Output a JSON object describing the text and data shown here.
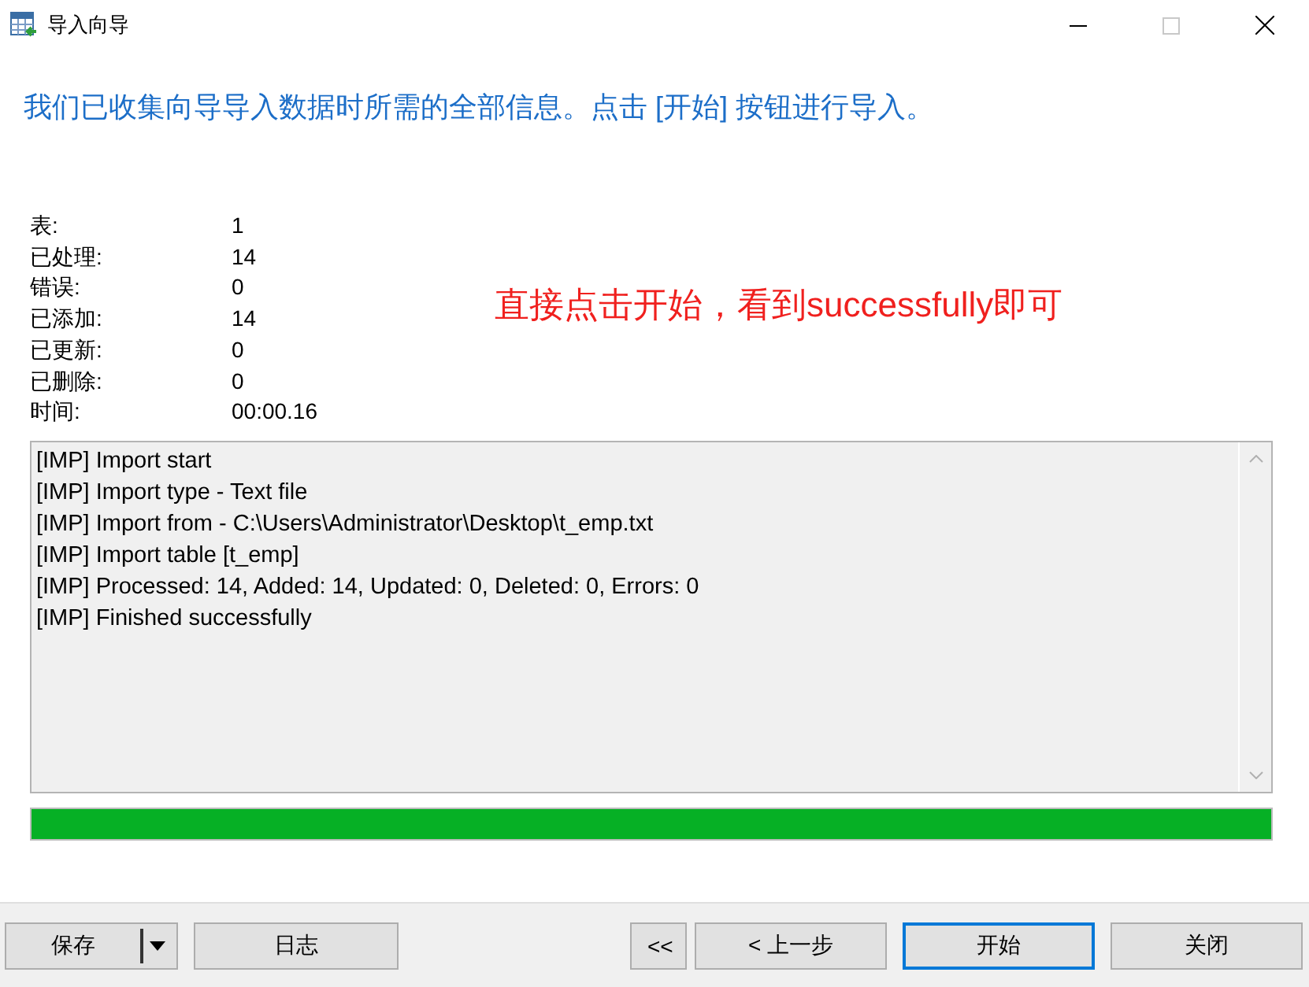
{
  "window": {
    "title": "导入向导"
  },
  "heading": "我们已收集向导导入数据时所需的全部信息。点击 [开始] 按钮进行导入。",
  "stats": [
    {
      "label": "表:",
      "value": "1"
    },
    {
      "label": "已处理:",
      "value": "14"
    },
    {
      "label": "错误:",
      "value": "0"
    },
    {
      "label": "已添加:",
      "value": "14"
    },
    {
      "label": "已更新:",
      "value": "0"
    },
    {
      "label": "已删除:",
      "value": "0"
    },
    {
      "label": "时间:",
      "value": "00:00.16"
    }
  ],
  "annotation": "直接点击开始，看到successfully即可",
  "log": [
    "[IMP] Import start",
    "[IMP] Import type - Text file",
    "[IMP] Import from - C:\\Users\\Administrator\\Desktop\\t_emp.txt",
    "[IMP] Import table [t_emp]",
    "[IMP] Processed: 14, Added: 14, Updated: 0, Deleted: 0, Errors: 0",
    "[IMP] Finished successfully"
  ],
  "progress": {
    "level": 1
  },
  "buttons": [
    {
      "label": "保存",
      "kind": "split",
      "default": false
    },
    {
      "label": "日志",
      "kind": "plain",
      "default": false
    },
    {
      "label": "<<",
      "kind": "narrow",
      "default": false
    },
    {
      "label": "< 上一步",
      "kind": "plain",
      "default": false
    },
    {
      "label": "开始",
      "kind": "plain",
      "default": true
    },
    {
      "label": "关闭",
      "kind": "plain",
      "default": false
    }
  ]
}
